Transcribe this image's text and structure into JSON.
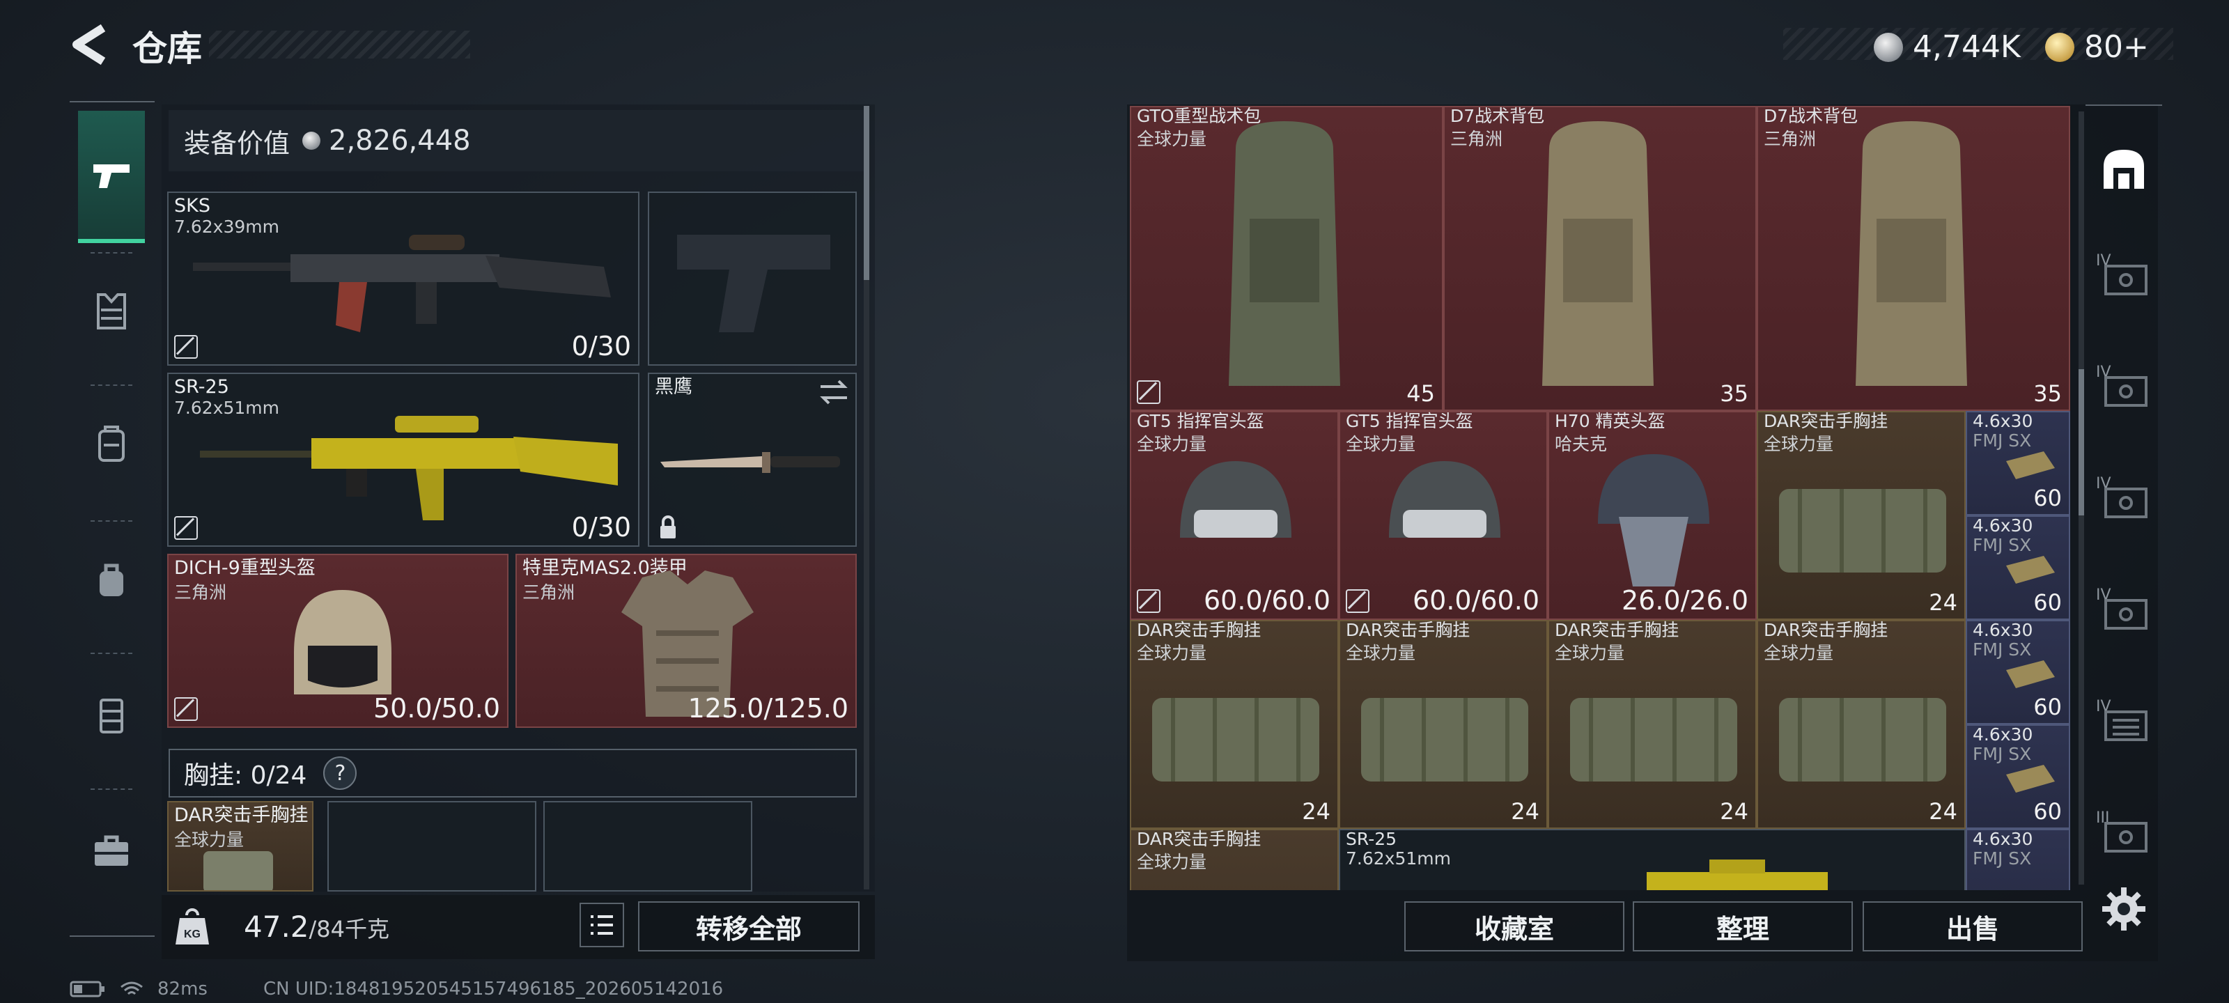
{
  "header": {
    "title": "仓库",
    "currency_silver": "4,744K",
    "currency_gold": "80+"
  },
  "left": {
    "value_label": "装备价值",
    "value_amount": "2,826,448",
    "primary": {
      "name": "SKS",
      "caliber": "7.62x39mm",
      "ammo": "0/30"
    },
    "secondary": {
      "name": "SR-25",
      "caliber": "7.62x51mm",
      "ammo": "0/30"
    },
    "melee": {
      "name": "黑鹰"
    },
    "helmet": {
      "name": "DICH-9重型头盔",
      "region": "三角洲",
      "durability": "50.0/50.0"
    },
    "armor": {
      "name": "特里克MAS2.0装甲",
      "region": "三角洲",
      "durability": "125.0/125.0"
    },
    "chest_label": "胸挂: 0/24",
    "chest_help": "?",
    "chest_item": {
      "name": "DAR突击手胸挂",
      "region": "全球力量"
    },
    "weight_value": "47.2",
    "weight_max": "/84千克",
    "transfer_all": "转移全部"
  },
  "right": {
    "row1": [
      {
        "name": "GTO重型战术包",
        "region": "全球力量",
        "count": "45"
      },
      {
        "name": "D7战术背包",
        "region": "三角洲",
        "count": "35"
      },
      {
        "name": "D7战术背包",
        "region": "三角洲",
        "count": "35"
      }
    ],
    "row2": [
      {
        "name": "GT5 指挥官头盔",
        "region": "全球力量",
        "durability": "60.0/60.0"
      },
      {
        "name": "GT5 指挥官头盔",
        "region": "全球力量",
        "durability": "60.0/60.0"
      },
      {
        "name": "H70 精英头盔",
        "region": "哈夫克",
        "durability": "26.0/26.0"
      },
      {
        "name": "DAR突击手胸挂",
        "region": "全球力量",
        "count": "24"
      }
    ],
    "row3": [
      {
        "name": "DAR突击手胸挂",
        "region": "全球力量",
        "count": "24"
      },
      {
        "name": "DAR突击手胸挂",
        "region": "全球力量",
        "count": "24"
      },
      {
        "name": "DAR突击手胸挂",
        "region": "全球力量",
        "count": "24"
      },
      {
        "name": "DAR突击手胸挂",
        "region": "全球力量",
        "count": "24"
      }
    ],
    "row4": [
      {
        "name": "DAR突击手胸挂",
        "region": "全球力量"
      },
      {
        "name": "SR-25",
        "region": "7.62x51mm"
      }
    ],
    "ammo": [
      {
        "name": "4.6x30",
        "sub": "FMJ SX",
        "count": "60"
      },
      {
        "name": "4.6x30",
        "sub": "FMJ SX",
        "count": "60"
      },
      {
        "name": "4.6x30",
        "sub": "FMJ SX",
        "count": "60"
      },
      {
        "name": "4.6x30",
        "sub": "FMJ SX",
        "count": "60"
      },
      {
        "name": "4.6x30",
        "sub": "FMJ SX",
        "count": ""
      }
    ],
    "buttons": {
      "collection": "收藏室",
      "organize": "整理",
      "sell": "出售"
    },
    "tier_labels": [
      "IV",
      "IV",
      "IV",
      "IV",
      "IV",
      "III"
    ]
  },
  "footer": {
    "ping": "82ms",
    "uid": "CN UID:18481952054515749618​5_202605142016"
  }
}
